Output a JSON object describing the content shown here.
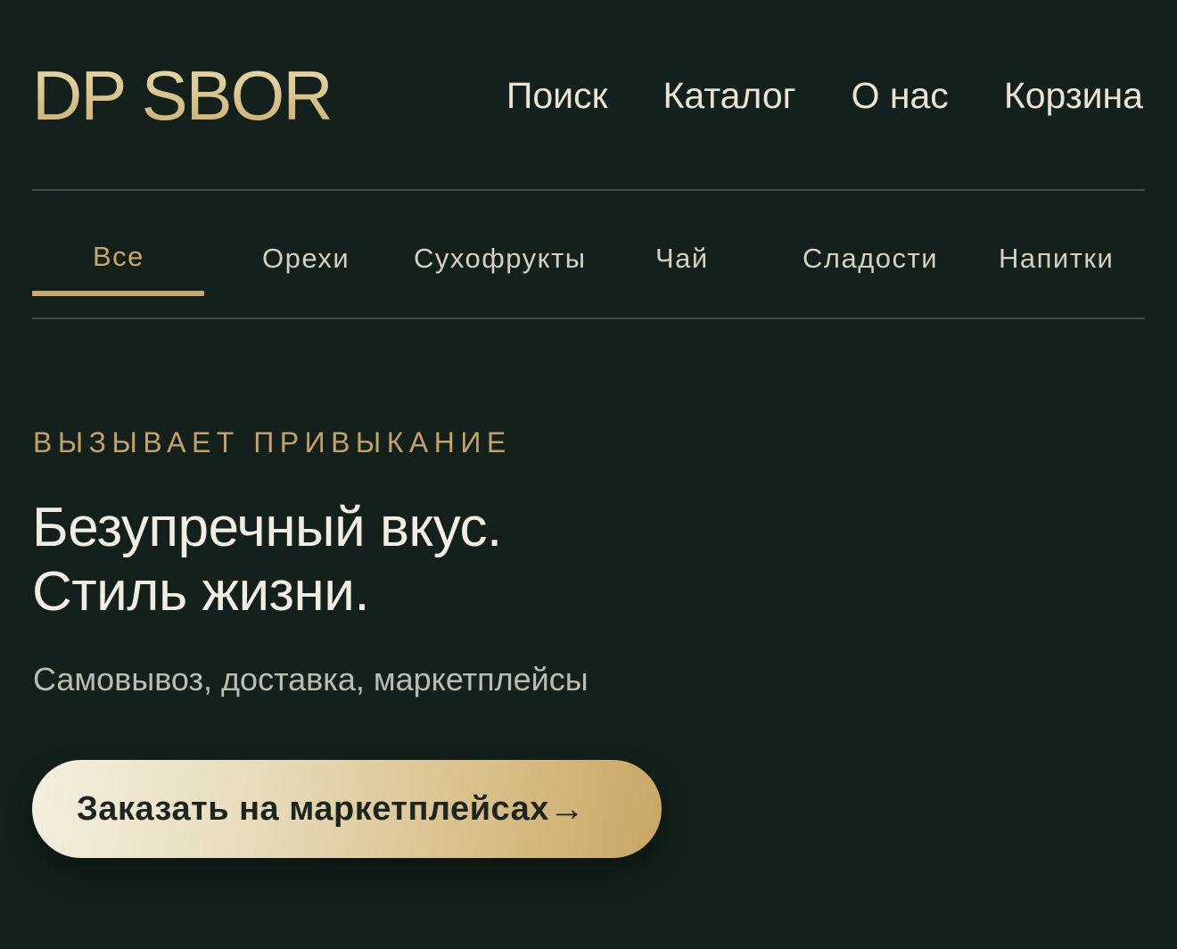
{
  "header": {
    "logo": "DP SBOR",
    "nav": [
      {
        "label": "Поиск"
      },
      {
        "label": "Каталог"
      },
      {
        "label": "О нас"
      },
      {
        "label": "Корзина"
      }
    ]
  },
  "category_tabs": {
    "active": "Все",
    "items": [
      {
        "label": "Все"
      },
      {
        "label": "Орехи"
      },
      {
        "label": "Сухофрукты"
      },
      {
        "label": "Чай"
      },
      {
        "label": "Сладости"
      },
      {
        "label": "Напитки"
      }
    ]
  },
  "hero": {
    "eyebrow": "ВЫЗЫВАЕТ ПРИВЫКАНИЕ",
    "headline_line1": "Безупречный вкус.",
    "headline_line2": "Стиль жизни.",
    "subtitle": "Самовывоз, доставка, маркетплейсы",
    "cta_label": "Заказать на маркетплейсах",
    "cta_arrow": "→"
  },
  "colors": {
    "background": "#13201b",
    "gold_accent": "#c9a86b",
    "logo_gold": "#d9c48c",
    "text_primary": "#f0ede5",
    "divider": "#4a4a38"
  }
}
